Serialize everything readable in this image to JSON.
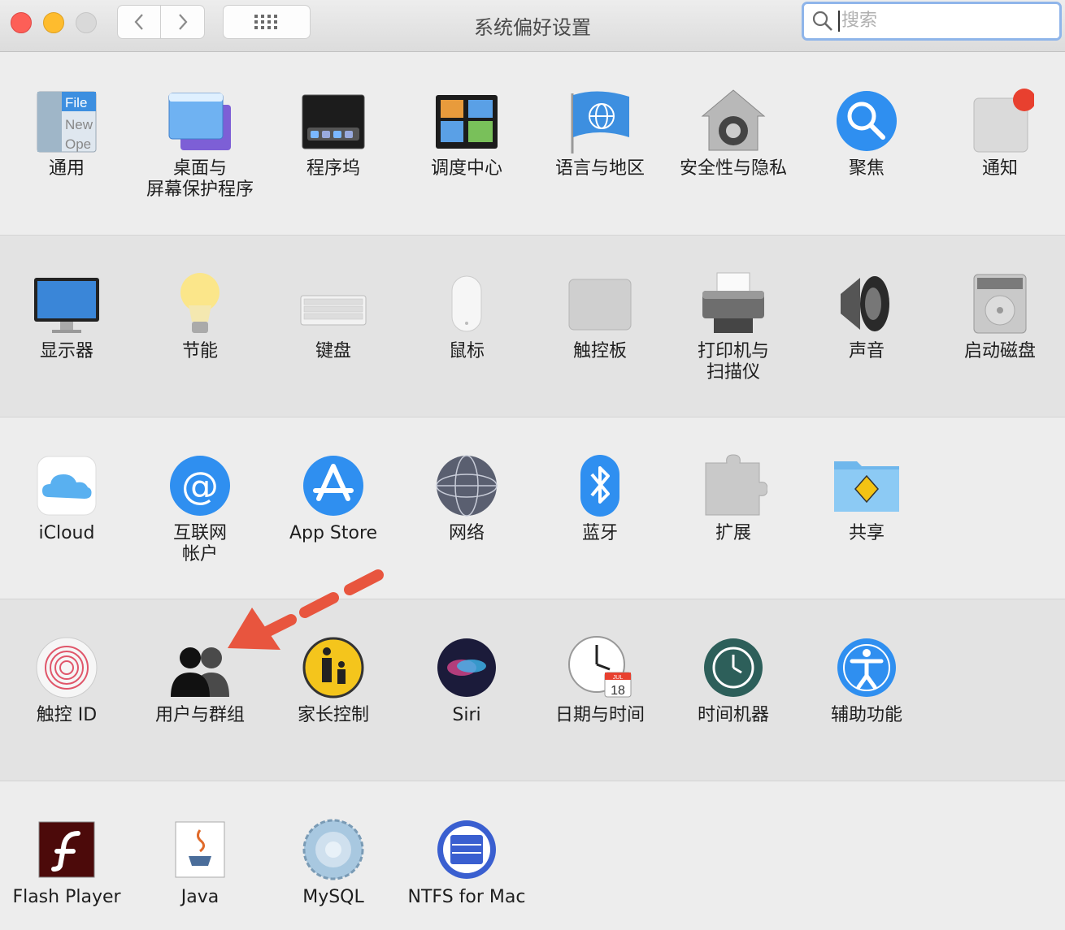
{
  "window": {
    "title": "系统偏好设置",
    "search_placeholder": "搜索",
    "colors": {
      "close": "#fd5f57",
      "minimize": "#febc2e",
      "search_focus": "#8fb5ea",
      "annotation_arrow": "#e8553e"
    }
  },
  "rows": [
    [
      {
        "label": "通用",
        "icon": "general-icon"
      },
      {
        "label": "桌面与\n屏幕保护程序",
        "icon": "desktop-screensaver-icon"
      },
      {
        "label": "程序坞",
        "icon": "dock-icon"
      },
      {
        "label": "调度中心",
        "icon": "mission-control-icon"
      },
      {
        "label": "语言与地区",
        "icon": "language-region-icon"
      },
      {
        "label": "安全性与隐私",
        "icon": "security-privacy-icon"
      },
      {
        "label": "聚焦",
        "icon": "spotlight-icon"
      },
      {
        "label": "通知",
        "icon": "notifications-icon"
      }
    ],
    [
      {
        "label": "显示器",
        "icon": "displays-icon"
      },
      {
        "label": "节能",
        "icon": "energy-saver-icon"
      },
      {
        "label": "键盘",
        "icon": "keyboard-icon"
      },
      {
        "label": "鼠标",
        "icon": "mouse-icon"
      },
      {
        "label": "触控板",
        "icon": "trackpad-icon"
      },
      {
        "label": "打印机与\n扫描仪",
        "icon": "printer-scanner-icon"
      },
      {
        "label": "声音",
        "icon": "sound-icon"
      },
      {
        "label": "启动磁盘",
        "icon": "startup-disk-icon"
      }
    ],
    [
      {
        "label": "iCloud",
        "icon": "icloud-icon"
      },
      {
        "label": "互联网\n帐户",
        "icon": "internet-accounts-icon"
      },
      {
        "label": "App Store",
        "icon": "app-store-icon"
      },
      {
        "label": "网络",
        "icon": "network-icon"
      },
      {
        "label": "蓝牙",
        "icon": "bluetooth-icon"
      },
      {
        "label": "扩展",
        "icon": "extensions-icon"
      },
      {
        "label": "共享",
        "icon": "sharing-icon"
      }
    ],
    [
      {
        "label": "触控 ID",
        "icon": "touch-id-icon"
      },
      {
        "label": "用户与群组",
        "icon": "users-groups-icon"
      },
      {
        "label": "家长控制",
        "icon": "parental-controls-icon"
      },
      {
        "label": "Siri",
        "icon": "siri-icon"
      },
      {
        "label": "日期与时间",
        "icon": "date-time-icon"
      },
      {
        "label": "时间机器",
        "icon": "time-machine-icon"
      },
      {
        "label": "辅助功能",
        "icon": "accessibility-icon"
      }
    ],
    [
      {
        "label": "Flash Player",
        "icon": "flash-player-icon"
      },
      {
        "label": "Java",
        "icon": "java-icon"
      },
      {
        "label": "MySQL",
        "icon": "mysql-icon"
      },
      {
        "label": "NTFS for Mac",
        "icon": "ntfs-for-mac-icon"
      }
    ]
  ],
  "icon_text": {
    "general": [
      "File",
      "New",
      "Ope"
    ],
    "calendar_month": "JUL",
    "calendar_day": "18"
  }
}
